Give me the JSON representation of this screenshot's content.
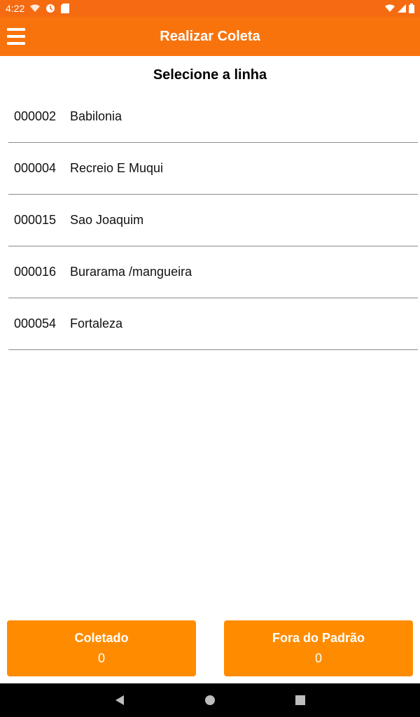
{
  "status_bar": {
    "time": "4:22"
  },
  "app_bar": {
    "title": "Realizar Coleta"
  },
  "main": {
    "heading": "Selecione a linha",
    "lines": [
      {
        "code": "000002",
        "name": "Babilonia"
      },
      {
        "code": "000004",
        "name": "Recreio E Muqui"
      },
      {
        "code": "000015",
        "name": "Sao Joaquim"
      },
      {
        "code": "000016",
        "name": "Burarama /mangueira"
      },
      {
        "code": "000054",
        "name": "Fortaleza"
      }
    ]
  },
  "footer": {
    "collected": {
      "label": "Coletado",
      "value": "0"
    },
    "out_of_standard": {
      "label": "Fora do Padrão",
      "value": "0"
    }
  },
  "colors": {
    "status_bar": "#F56B11",
    "app_bar": "#F9730D",
    "button": "#FF8C00"
  },
  "icons": [
    "wifi-icon",
    "clock-icon",
    "sd-card-icon",
    "wifi-signal-icon",
    "cell-signal-icon",
    "battery-icon",
    "menu-icon",
    "back-icon",
    "home-icon",
    "recents-icon"
  ]
}
